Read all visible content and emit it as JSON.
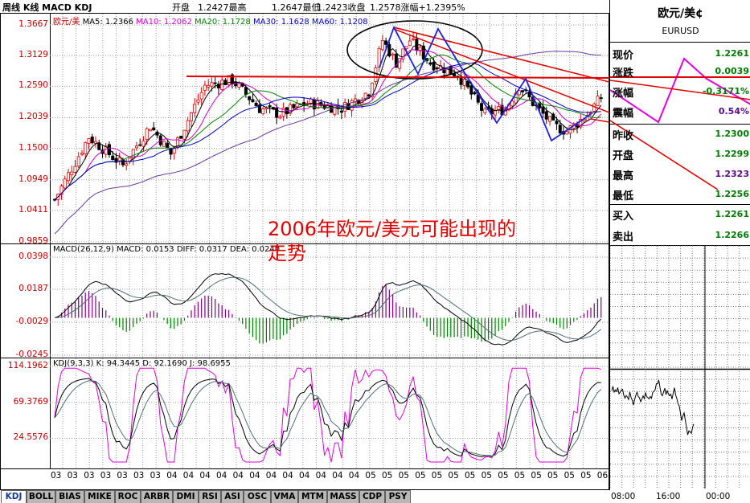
{
  "header": {
    "title": "周线 K线 MACD KDJ",
    "open_label": "开盘",
    "open": "1.2427最高",
    "high": "1.2647最低",
    "low": "1.2423收盘",
    "close_change": "1.2578涨幅+1.2395%"
  },
  "main": {
    "legend": {
      "symbol": "欧元/美",
      "ma5": "MA5: 1.2366",
      "ma10": "MA10: 1.2062",
      "ma20": "MA20: 1.1728",
      "ma30": "MA30: 1.1628",
      "ma60": "MA60: 1.1208"
    },
    "yticks": [
      "1.3667",
      "1.3129",
      "1.2590",
      "1.2039",
      "1.1500",
      "1.0949",
      "1.0411",
      "0.9859"
    ],
    "xticks": [
      "03",
      "03",
      "03",
      "03",
      "03",
      "03",
      "03",
      "04",
      "04",
      "04",
      "04",
      "04",
      "04",
      "04",
      "04",
      "04",
      "04",
      "04",
      "04",
      "05",
      "05",
      "05",
      "05",
      "05",
      "05",
      "05",
      "05",
      "05",
      "05",
      "05",
      "05",
      "05",
      "05",
      "06"
    ],
    "annotation_line1": "2006年欧元/美元可能出现的",
    "annotation_line2": "走势"
  },
  "macd": {
    "legend": "MACD(26,12,9) MACD: 0.0153 DIFF: 0.0317 DEA: 0.0240",
    "yticks": [
      "0.0398",
      "0.0187",
      "-0.0029",
      "-0.0245"
    ]
  },
  "kdj": {
    "legend": "KDJ(9,3,3) K: 94.3445 D: 92.1690 J: 98.6955",
    "yticks": [
      "114.1962",
      "69.3769",
      "24.5576"
    ]
  },
  "quote_panel": {
    "name": "欧元/美¢",
    "code": "EURUSD",
    "rows": [
      {
        "label": "现价",
        "value": "1.2261",
        "color": "#007a00"
      },
      {
        "label": "涨跌",
        "value": "0.0039",
        "color": "#007a00"
      },
      {
        "label": "涨幅",
        "value": "-0.3171%",
        "color": "#007a00"
      },
      {
        "label": "震幅",
        "value": "0.54%",
        "color": "#5a0a8a"
      },
      {
        "label": "昨收",
        "value": "1.2300",
        "color": "#007a00"
      },
      {
        "label": "开盘",
        "value": "1.2299",
        "color": "#007a00"
      },
      {
        "label": "最高",
        "value": "1.2323",
        "color": "#5a0a8a"
      },
      {
        "label": "最低",
        "value": "1.2256",
        "color": "#007a00"
      },
      {
        "label": "买入",
        "value": "1.2261",
        "color": "#007a00"
      },
      {
        "label": "卖出",
        "value": "1.2266",
        "color": "#007a00"
      }
    ],
    "time_labels": [
      "08:00",
      "16:00",
      "00:00"
    ]
  },
  "tabs": [
    "KDJ",
    "BOLL",
    "BIAS",
    "MIKE",
    "ROC",
    "ARBR",
    "DMI",
    "RSI",
    "ASI",
    "OSC",
    "VMA",
    "MTM",
    "MASS",
    "CDP",
    "PSY"
  ],
  "colors": {
    "up": "#e00000",
    "down": "#000000",
    "macd_neg": "#008000",
    "macd_pos": "#800080",
    "grid": "#8c8c8c"
  }
}
